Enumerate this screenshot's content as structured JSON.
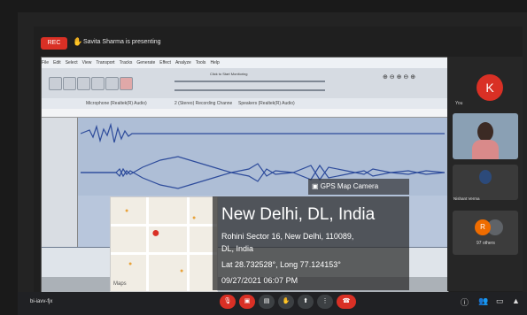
{
  "meeting": {
    "rec_label": "REC",
    "presenting_text": "Savita Sharma is presenting",
    "code": "bi-iavv-fjx"
  },
  "audacity": {
    "title": "Audacity",
    "menu": [
      "File",
      "Edit",
      "Select",
      "View",
      "Transport",
      "Tracks",
      "Generate",
      "Effect",
      "Analyze",
      "Tools",
      "Help"
    ],
    "device_mic": "Microphone (Realtek(R) Audio)",
    "device_channels": "2 (Stereo) Recording Channe",
    "device_speaker": "Speakers (Realtek(R) Audio)",
    "monitor_text": "Click to Start Monitoring"
  },
  "gps": {
    "camera_label": "GPS Map Camera",
    "city": "New Delhi, DL, India",
    "address_line1": "Rohini Sector 16, New Delhi, 110089,",
    "address_line2": "DL, India",
    "latlong": "Lat 28.732528°, Long 77.124153°",
    "datetime": "09/27/2021 06:07 PM",
    "maps_logo": "Maps"
  },
  "participants": {
    "you_initial": "K",
    "you_label": "You",
    "tile2_name": "Nishant Verma",
    "others_initial": "R",
    "others_label": "97 others"
  },
  "colors": {
    "rec_red": "#d93025",
    "wave_blue": "#2d4b9b",
    "track_bg": "#aebed6"
  }
}
